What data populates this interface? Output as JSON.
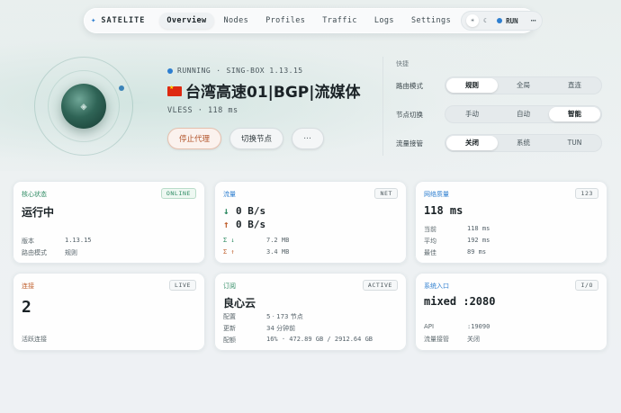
{
  "app": {
    "brand": "SATELITE"
  },
  "nav": {
    "tabs": [
      {
        "label": "Overview",
        "active": true
      },
      {
        "label": "Nodes"
      },
      {
        "label": "Profiles"
      },
      {
        "label": "Traffic"
      },
      {
        "label": "Logs"
      },
      {
        "label": "Settings"
      }
    ],
    "run_label": "RUN",
    "more": "⋯"
  },
  "status": {
    "state": "RUNNING",
    "sep": "·",
    "engine": "SING-BOX 1.13.15",
    "node_name": "台湾高速01|BGP|流媒体",
    "node_meta": "VLESS · 118 ms",
    "stop_label": "停止代理",
    "switch_label": "切换节点",
    "more": "⋯"
  },
  "quick": {
    "title": "快捷",
    "rows": [
      {
        "label": "路由模式",
        "options": [
          "规则",
          "全局",
          "直连"
        ],
        "selected": 0
      },
      {
        "label": "节点切换",
        "options": [
          "手动",
          "自动",
          "智能"
        ],
        "selected": 2
      },
      {
        "label": "流量接管",
        "options": [
          "关闭",
          "系统",
          "TUN"
        ],
        "selected": 0
      }
    ]
  },
  "cards": {
    "core": {
      "title": "核心状态",
      "badge": "ONLINE",
      "value": "运行中",
      "k1": "版本",
      "v1": "1.13.15",
      "k2": "路由模式",
      "v2": "规则"
    },
    "traffic": {
      "title": "流量",
      "badge": "NET",
      "down_rate": "0 B/s",
      "up_rate": "0 B/s",
      "down_total_label": "Σ ↓",
      "down_total": "7.2 MB",
      "up_total_label": "Σ ↑",
      "up_total": "3.4 MB"
    },
    "quality": {
      "title": "网络质量",
      "badge": "123",
      "value": "118 ms",
      "k1": "当前",
      "v1": "118 ms",
      "k2": "平均",
      "v2": "192 ms",
      "k3": "最佳",
      "v3": "89 ms"
    },
    "conn": {
      "title": "连接",
      "badge": "LIVE",
      "value": "2",
      "k1": "活跃连接"
    },
    "sub": {
      "title": "订阅",
      "badge": "ACTIVE",
      "value": "良心云",
      "k1": "配置",
      "v1": "5 · 173 节点",
      "k2": "更新",
      "v2": "34 分钟前",
      "k3": "配额",
      "v3": "16% · 472.89 GB / 2912.64 GB"
    },
    "entry": {
      "title": "系统入口",
      "badge": "I/O",
      "value": "mixed :2080",
      "k1": "API",
      "v1": ":19090",
      "k2": "流量接管",
      "v2": "关闭"
    }
  },
  "colors": {
    "accent": "#2e7fd0",
    "green": "#2d8a62",
    "orange": "#c0612f",
    "core_title": "#2d8a62",
    "traffic_title": "#2e7fd0",
    "quality_title": "#2e7fd0",
    "conn_title": "#c0612f",
    "sub_title": "#2d8a62",
    "entry_title": "#2e7fd0"
  }
}
